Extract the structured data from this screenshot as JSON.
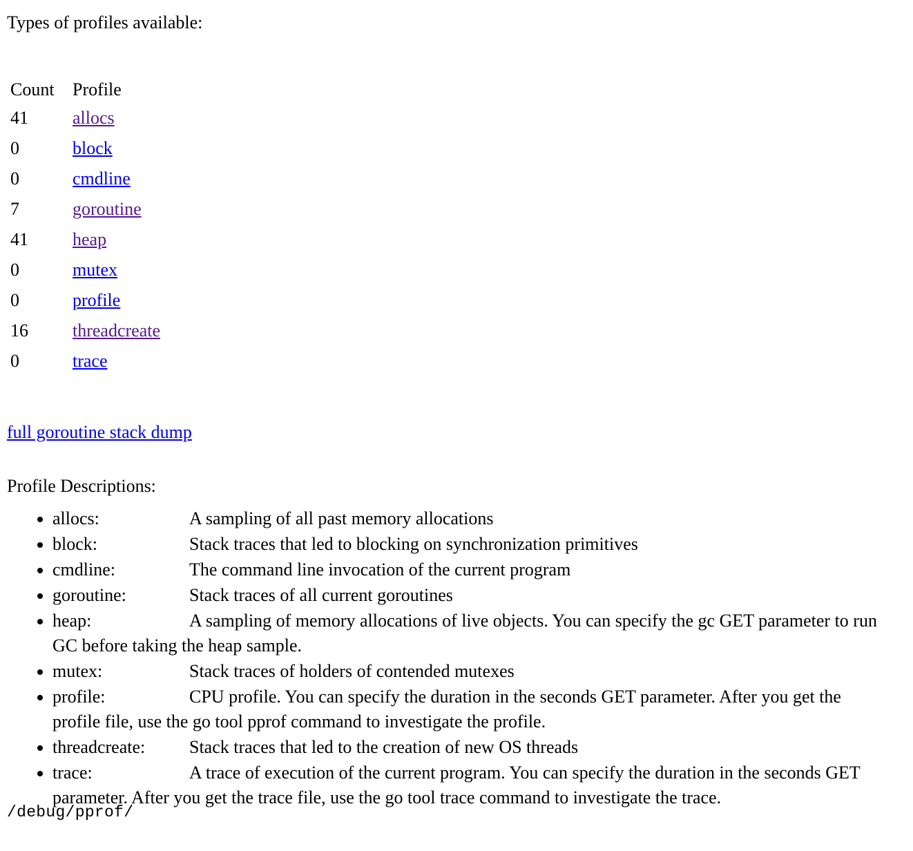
{
  "page": {
    "intro_text": "Types of profiles available:",
    "descriptions_heading": "Profile Descriptions:",
    "footer_path": "/debug/pprof/",
    "link_color": "#0000ee",
    "visited_link_color": "#551a8b",
    "text_color": "#000000",
    "background_color": "#ffffff"
  },
  "profile_table": {
    "headers": {
      "count": "Count",
      "profile": "Profile"
    },
    "rows": [
      {
        "count": "41",
        "profile": "allocs",
        "visited": true
      },
      {
        "count": "0",
        "profile": "block",
        "visited": false
      },
      {
        "count": "0",
        "profile": "cmdline",
        "visited": false
      },
      {
        "count": "7",
        "profile": "goroutine",
        "visited": true
      },
      {
        "count": "41",
        "profile": "heap",
        "visited": true
      },
      {
        "count": "0",
        "profile": "mutex",
        "visited": false
      },
      {
        "count": "0",
        "profile": "profile",
        "visited": false
      },
      {
        "count": "16",
        "profile": "threadcreate",
        "visited": true
      },
      {
        "count": "0",
        "profile": "trace",
        "visited": false
      }
    ]
  },
  "dump_link": {
    "label": "full goroutine stack dump"
  },
  "descriptions": [
    {
      "label": "allocs:",
      "text": "A sampling of all past memory allocations"
    },
    {
      "label": "block:",
      "text": "Stack traces that led to blocking on synchronization primitives"
    },
    {
      "label": "cmdline:",
      "text": "The command line invocation of the current program"
    },
    {
      "label": "goroutine:",
      "text": "Stack traces of all current goroutines"
    },
    {
      "label": "heap:",
      "text": "A sampling of memory allocations of live objects. You can specify the gc GET parameter to run GC before taking the heap sample."
    },
    {
      "label": "mutex:",
      "text": "Stack traces of holders of contended mutexes"
    },
    {
      "label": "profile:",
      "text": "CPU profile. You can specify the duration in the seconds GET parameter. After you get the profile file, use the go tool pprof command to investigate the profile."
    },
    {
      "label": "threadcreate:",
      "text": "Stack traces that led to the creation of new OS threads"
    },
    {
      "label": "trace:",
      "text": "A trace of execution of the current program. You can specify the duration in the seconds GET parameter. After you get the trace file, use the go tool trace command to investigate the trace."
    }
  ]
}
